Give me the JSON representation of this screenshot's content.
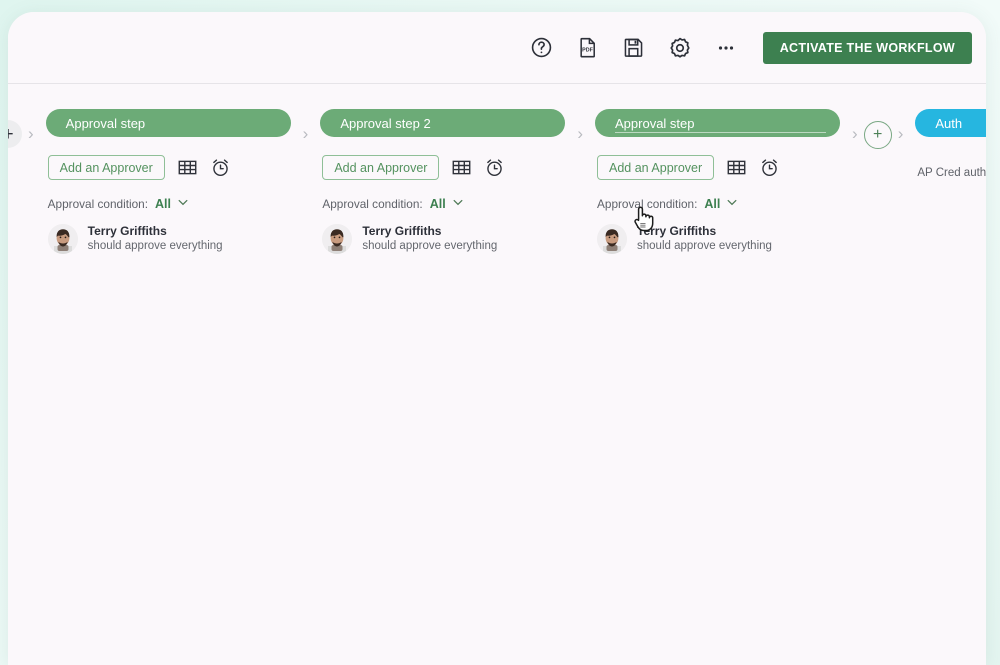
{
  "window": {
    "background_accent": "#e4f5f0",
    "surface": "#fbf8fb"
  },
  "toolbar": {
    "icons": [
      {
        "name": "help-icon",
        "label": "Help"
      },
      {
        "name": "pdf-icon",
        "label": "PDF"
      },
      {
        "name": "save-icon",
        "label": "Save"
      },
      {
        "name": "gear-icon",
        "label": "Settings"
      },
      {
        "name": "more-icon",
        "label": "More"
      }
    ],
    "activate_label": "ACTIVATE THE WORKFLOW",
    "activate_color": "#3d8050"
  },
  "workflow": {
    "add_left_label": "+",
    "chevron": "›",
    "add_step_label": "+",
    "steps": [
      {
        "title": "Approval step",
        "color": "#6cab77",
        "editing": false,
        "add_approver_label": "Add an Approver",
        "grid_icon": "table-icon",
        "clock_icon": "alarm-clock-icon",
        "condition_label": "Approval condition:",
        "condition_value": "All",
        "approver_name": "Terry Griffiths",
        "approver_sub": "should approve everything"
      },
      {
        "title": "Approval step 2",
        "color": "#6cab77",
        "editing": false,
        "add_approver_label": "Add an Approver",
        "grid_icon": "table-icon",
        "clock_icon": "alarm-clock-icon",
        "condition_label": "Approval condition:",
        "condition_value": "All",
        "approver_name": "Terry Griffiths",
        "approver_sub": "should approve everything"
      },
      {
        "title": "Approval step",
        "color": "#6cab77",
        "editing": true,
        "add_approver_label": "Add an Approver",
        "grid_icon": "table-icon",
        "clock_icon": "alarm-clock-icon",
        "condition_label": "Approval condition:",
        "condition_value": "All",
        "approver_name": "Terry Griffiths",
        "approver_sub": "should approve everything"
      }
    ],
    "final_step": {
      "title": "Auth",
      "color": "#26b6e0",
      "subtitle": "AP Cred\nauthoris"
    }
  }
}
